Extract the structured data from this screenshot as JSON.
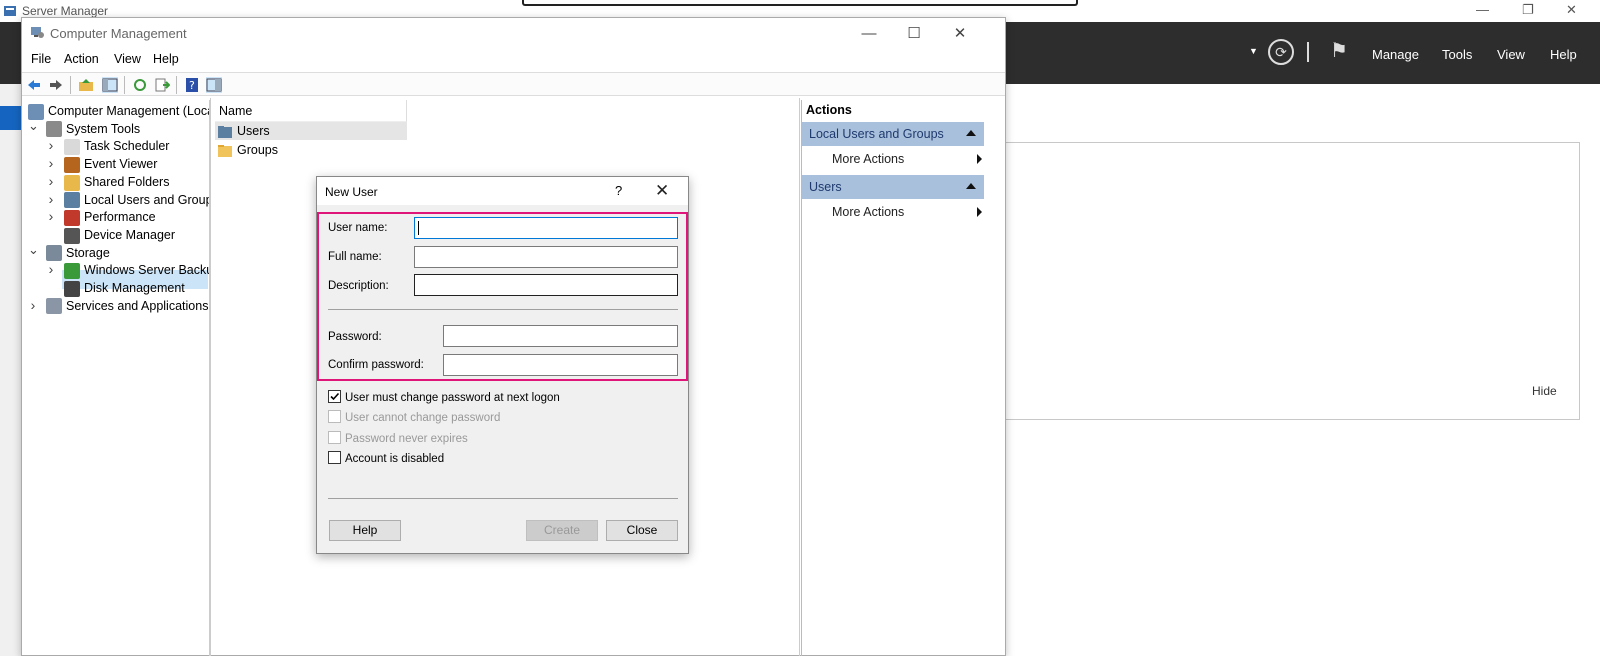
{
  "server_manager": {
    "title": "Server Manager",
    "menu": [
      "Manage",
      "Tools",
      "View",
      "Help"
    ],
    "hide_label": "Hide"
  },
  "computer_management": {
    "title": "Computer Management",
    "menu": [
      "File",
      "Action",
      "View",
      "Help"
    ],
    "tree": [
      {
        "label": "Computer Management (Local",
        "level": 0,
        "expander": "",
        "icon": "computer-icon"
      },
      {
        "label": "System Tools",
        "level": 1,
        "expander": "v",
        "icon": "tools-icon"
      },
      {
        "label": "Task Scheduler",
        "level": 2,
        "expander": ">",
        "icon": "clock-icon"
      },
      {
        "label": "Event Viewer",
        "level": 2,
        "expander": ">",
        "icon": "event-icon"
      },
      {
        "label": "Shared Folders",
        "level": 2,
        "expander": ">",
        "icon": "shared-folder-icon"
      },
      {
        "label": "Local Users and Groups",
        "level": 2,
        "expander": ">",
        "icon": "users-icon",
        "selected": true
      },
      {
        "label": "Performance",
        "level": 2,
        "expander": ">",
        "icon": "performance-icon"
      },
      {
        "label": "Device Manager",
        "level": 2,
        "expander": "",
        "icon": "device-icon"
      },
      {
        "label": "Storage",
        "level": 1,
        "expander": "v",
        "icon": "storage-icon"
      },
      {
        "label": "Windows Server Backup",
        "level": 2,
        "expander": ">",
        "icon": "backup-icon"
      },
      {
        "label": "Disk Management",
        "level": 2,
        "expander": "",
        "icon": "disk-icon"
      },
      {
        "label": "Services and Applications",
        "level": 1,
        "expander": ">",
        "icon": "services-icon"
      }
    ],
    "list_header": "Name",
    "list_items": [
      "Users",
      "Groups"
    ],
    "actions": {
      "title": "Actions",
      "groups": [
        {
          "header": "Local Users and Groups",
          "item": "More Actions"
        },
        {
          "header": "Users",
          "item": "More Actions"
        }
      ]
    }
  },
  "dialog": {
    "title": "New User",
    "help_glyph": "?",
    "fields": [
      {
        "label": "User name:",
        "value": ""
      },
      {
        "label": "Full name:",
        "value": ""
      },
      {
        "label": "Description:",
        "value": ""
      },
      {
        "label": "Password:",
        "value": ""
      },
      {
        "label": "Confirm password:",
        "value": ""
      }
    ],
    "checkboxes": [
      {
        "label": "User must change password at next logon",
        "checked": true,
        "disabled": false
      },
      {
        "label": "User cannot change password",
        "checked": false,
        "disabled": true
      },
      {
        "label": "Password never expires",
        "checked": false,
        "disabled": true
      },
      {
        "label": "Account is disabled",
        "checked": false,
        "disabled": false
      }
    ],
    "buttons": {
      "help": "Help",
      "create": "Create",
      "close": "Close"
    },
    "highlight_color": "#e0157a"
  }
}
